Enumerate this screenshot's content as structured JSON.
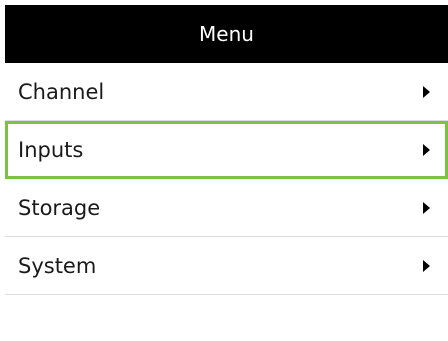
{
  "header": {
    "title": "Menu"
  },
  "menu": {
    "items": [
      {
        "label": "Channel",
        "icon": "chevron-right-icon"
      },
      {
        "label": "Inputs",
        "icon": "chevron-right-icon",
        "selected": true
      },
      {
        "label": "Storage",
        "icon": "chevron-right-icon"
      },
      {
        "label": "System",
        "icon": "chevron-right-icon"
      }
    ]
  },
  "colors": {
    "header_bg": "#000000",
    "header_text": "#ffffff",
    "selection_border": "#7cc242",
    "divider": "#dcdcdc"
  }
}
